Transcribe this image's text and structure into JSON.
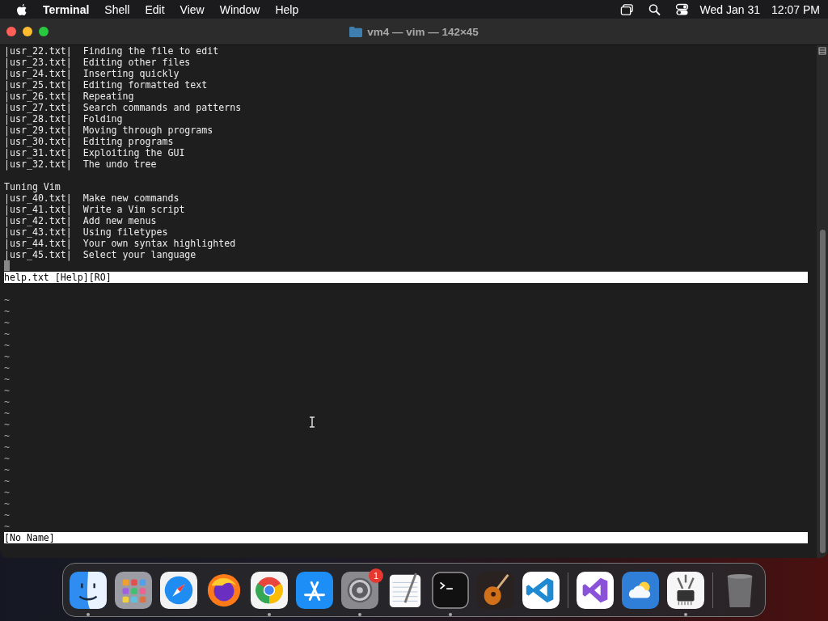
{
  "menubar": {
    "app": "Terminal",
    "menus": [
      "Shell",
      "Edit",
      "View",
      "Window",
      "Help"
    ],
    "date": "Wed Jan 31",
    "time": "12:07 PM"
  },
  "window": {
    "title": "vm4 — vim — 142×45"
  },
  "vim": {
    "sections": [
      {
        "lines": [
          "|usr_22.txt|  Finding the file to edit",
          "|usr_23.txt|  Editing other files",
          "|usr_24.txt|  Inserting quickly",
          "|usr_25.txt|  Editing formatted text",
          "|usr_26.txt|  Repeating",
          "|usr_27.txt|  Search commands and patterns",
          "|usr_28.txt|  Folding",
          "|usr_29.txt|  Moving through programs",
          "|usr_30.txt|  Editing programs",
          "|usr_31.txt|  Exploiting the GUI",
          "|usr_32.txt|  The undo tree"
        ]
      },
      {
        "heading": "Tuning Vim",
        "lines": [
          "|usr_40.txt|  Make new commands",
          "|usr_41.txt|  Write a Vim script",
          "|usr_42.txt|  Add new menus",
          "|usr_43.txt|  Using filetypes",
          "|usr_44.txt|  Your own syntax highlighted",
          "|usr_45.txt|  Select your language"
        ]
      }
    ],
    "top_status": "help.txt [Help][RO]",
    "bottom_lines": [
      "~",
      "~",
      "~",
      "~",
      "~",
      "~",
      "~",
      "~",
      "~",
      "~",
      "~",
      "~",
      "~",
      "~",
      "~",
      "~",
      "~",
      "~",
      "~",
      "~",
      "~"
    ],
    "bottom_status": "[No Name]"
  },
  "dock": {
    "groups": [
      [
        {
          "kind": "finder",
          "running": true
        },
        {
          "kind": "launchpad",
          "running": false
        },
        {
          "kind": "safari",
          "running": false
        },
        {
          "kind": "firefox",
          "running": false
        },
        {
          "kind": "chrome",
          "running": true
        },
        {
          "kind": "appstore",
          "running": false
        },
        {
          "kind": "settings",
          "running": true,
          "badge": "1"
        },
        {
          "kind": "textedit",
          "running": false
        },
        {
          "kind": "terminal",
          "running": true
        },
        {
          "kind": "guitar",
          "running": false
        },
        {
          "kind": "vscode",
          "running": false
        }
      ],
      [
        {
          "kind": "visualstudio",
          "running": false
        },
        {
          "kind": "weather",
          "running": false
        },
        {
          "kind": "sysinfo",
          "running": true
        }
      ],
      [
        {
          "kind": "trash",
          "running": false
        }
      ]
    ]
  }
}
